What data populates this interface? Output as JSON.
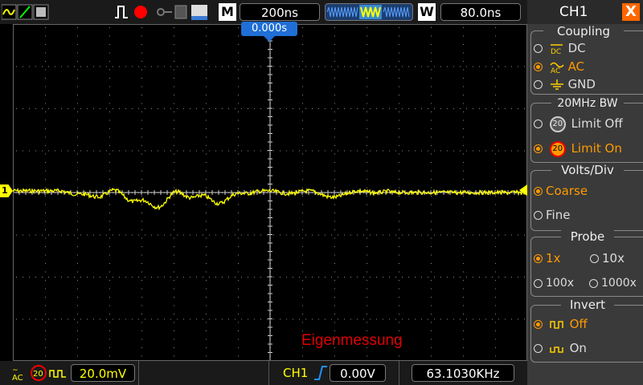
{
  "top_bar": {
    "mode_letter": "M",
    "timebase": "200ns",
    "window_letter": "W",
    "window_value": "80.0ns"
  },
  "screen": {
    "trigger_position": "0.000s",
    "channel_marker": "1",
    "overlay_label": "Eigenmessung",
    "trace_color": "#ffff00",
    "grid_color": "#8a8a8a",
    "label_color": "#e00000"
  },
  "bottom_bar": {
    "coupling_icon": "AC",
    "bw_icon": "20",
    "volts_div": "20.0mV",
    "trigger_channel": "CH1",
    "trigger_level": "0.00V",
    "frequency": "63.1030KHz"
  },
  "menu": {
    "title": "CH1",
    "close": "X",
    "coupling": {
      "title": "Coupling",
      "options": [
        {
          "icon": "DC",
          "label": "DC",
          "selected": false
        },
        {
          "icon": "AC",
          "label": "AC",
          "selected": true
        },
        {
          "icon": "GND",
          "label": "GND",
          "selected": false
        }
      ]
    },
    "bandwidth": {
      "title": "20MHz BW",
      "icon": "20",
      "options": [
        {
          "label": "Limit Off",
          "selected": false
        },
        {
          "label": "Limit On",
          "selected": true
        }
      ]
    },
    "volts_div": {
      "title": "Volts/Div",
      "options": [
        {
          "label": "Coarse",
          "selected": true
        },
        {
          "label": "Fine",
          "selected": false
        }
      ]
    },
    "probe": {
      "title": "Probe",
      "options": [
        {
          "label": "1x",
          "selected": true
        },
        {
          "label": "10x",
          "selected": false
        },
        {
          "label": "100x",
          "selected": false
        },
        {
          "label": "1000x",
          "selected": false
        }
      ]
    },
    "invert": {
      "title": "Invert",
      "options": [
        {
          "label": "Off",
          "selected": true
        },
        {
          "label": "On",
          "selected": false
        }
      ]
    }
  },
  "colors": {
    "accent_orange": "#ff9a00",
    "trigger_blue": "#1f6fd6",
    "close_orange": "#ff6600"
  }
}
